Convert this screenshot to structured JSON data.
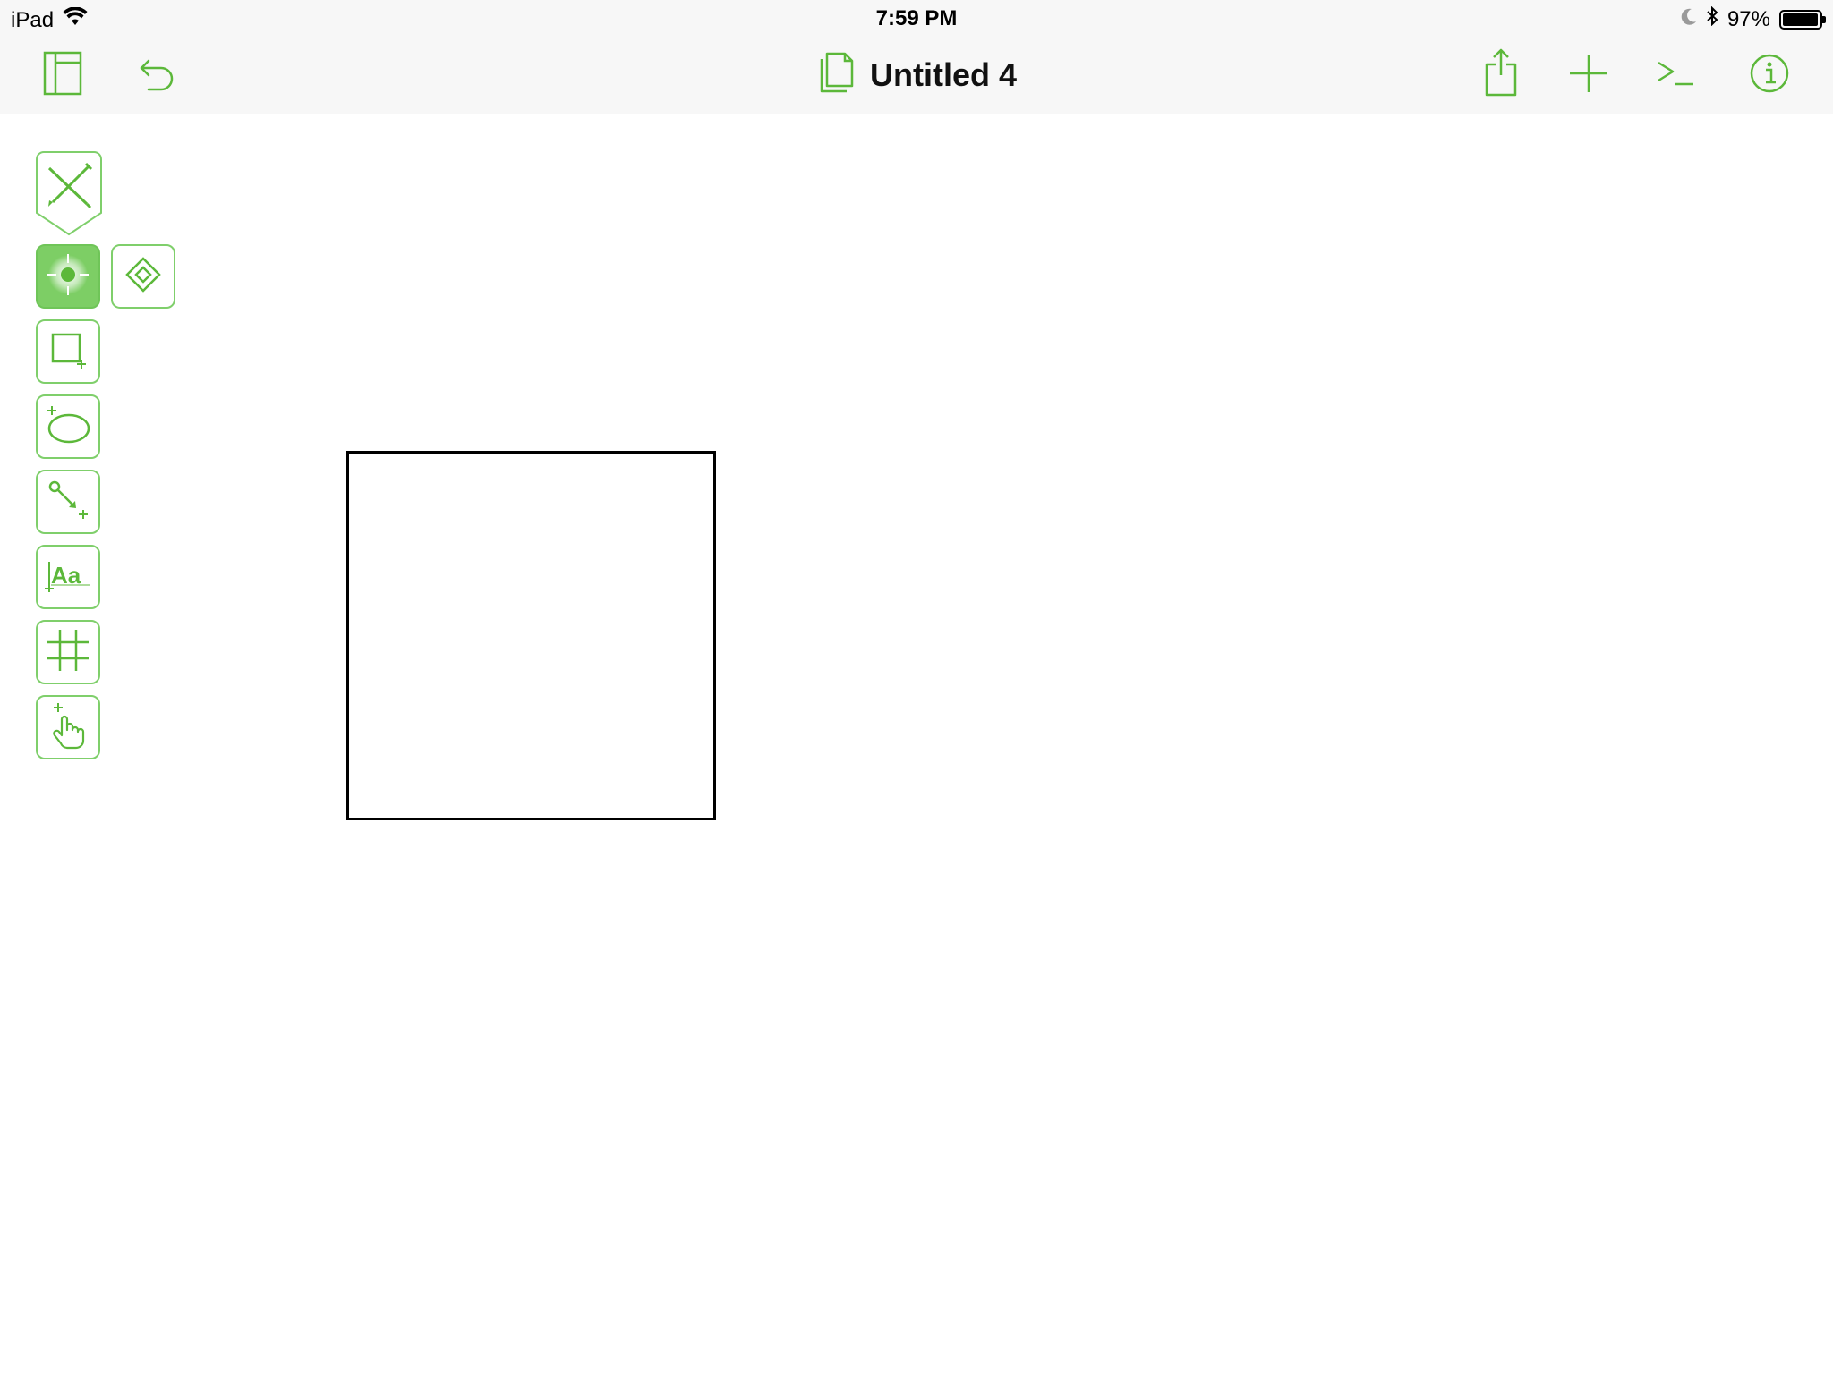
{
  "colors": {
    "accent": "#5cb83a",
    "accent_light": "#7fcf6b",
    "toolbar_bg": "#f7f7f7",
    "canvas_bg": "#ffffff",
    "shape_stroke": "#000000"
  },
  "status_bar": {
    "carrier": "iPad",
    "time": "7:59 PM",
    "battery": "97%",
    "battery_level": 0.97,
    "icons": [
      "wifi-icon",
      "moon-icon",
      "bluetooth-icon",
      "battery-icon"
    ]
  },
  "toolbar": {
    "title": "Untitled 4",
    "left_buttons": [
      "sidebar-toggle-icon",
      "undo-icon"
    ],
    "right_buttons": [
      "share-icon",
      "add-icon",
      "console-icon",
      "info-icon"
    ]
  },
  "tools": [
    {
      "name": "style-tools",
      "icon": "pencil-pen-icon"
    },
    {
      "name": "selection-tool",
      "icon": "selection-target-icon",
      "active": true
    },
    {
      "name": "point-editor-tool",
      "icon": "diamond-icon"
    },
    {
      "name": "shape-tool",
      "icon": "rectangle-plus-icon"
    },
    {
      "name": "lasso-tool",
      "icon": "lasso-icon"
    },
    {
      "name": "line-tool",
      "icon": "line-arrow-icon"
    },
    {
      "name": "text-tool",
      "icon": "text-aa-icon",
      "label": "Aa"
    },
    {
      "name": "diagram-tool",
      "icon": "crop-grid-icon"
    },
    {
      "name": "browse-tool",
      "icon": "hand-pointer-icon"
    }
  ],
  "canvas": {
    "shapes": [
      {
        "type": "rectangle",
        "stroke": "#000000",
        "fill": "none"
      }
    ]
  }
}
